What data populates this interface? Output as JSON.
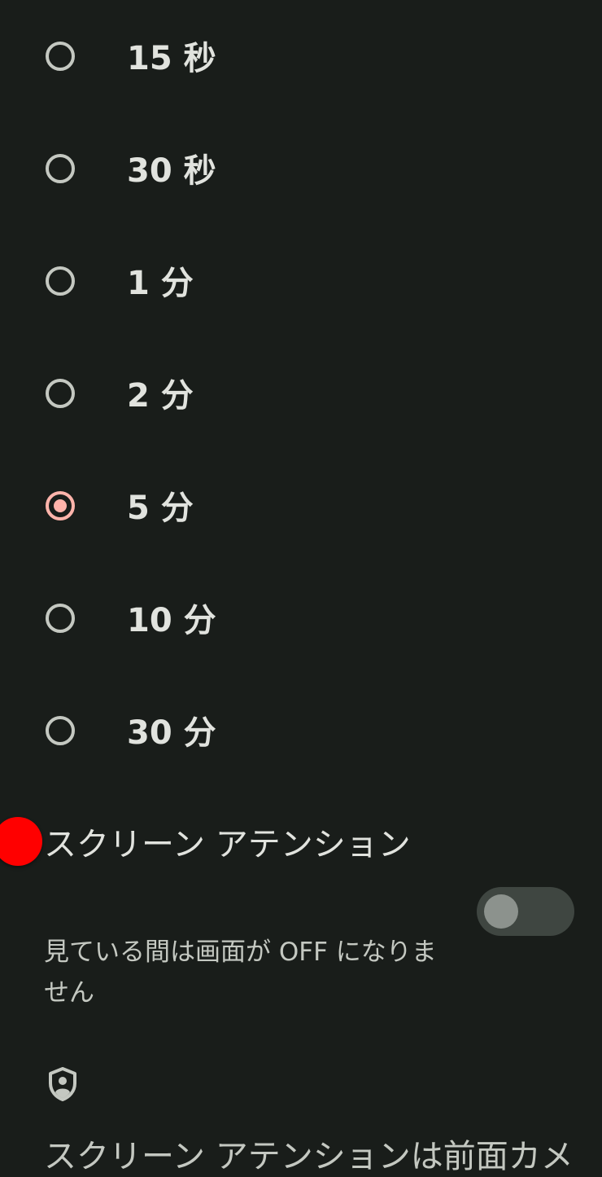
{
  "timeout_options": [
    {
      "label": "15 秒",
      "selected": false
    },
    {
      "label": "30 秒",
      "selected": false
    },
    {
      "label": "1 分",
      "selected": false
    },
    {
      "label": "2 分",
      "selected": false
    },
    {
      "label": "5 分",
      "selected": true
    },
    {
      "label": "10 分",
      "selected": false
    },
    {
      "label": "30 分",
      "selected": false
    }
  ],
  "screen_attention": {
    "title": "スクリーン アテンション",
    "summary": "見ている間は画面が OFF になりません",
    "enabled": false
  },
  "footer": {
    "icon": "shield-person-icon",
    "text": "スクリーン アテンションは前面カメ"
  },
  "colors": {
    "background": "#191d1a",
    "radio_selected": "#ffb4ab",
    "radio_unselected": "#c4c8c1",
    "toggle_track_off": "#3f4641",
    "toggle_thumb_off": "#8c928d",
    "touch_indicator": "#ff0000"
  }
}
